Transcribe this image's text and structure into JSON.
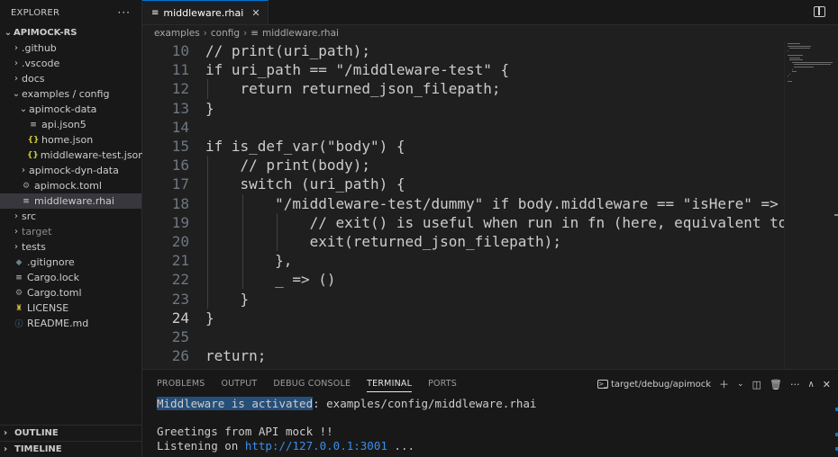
{
  "sidebar": {
    "title": "EXPLORER",
    "more": "···",
    "root": "APIMOCK-RS",
    "items": [
      {
        "label": ".github",
        "chev": "›",
        "indent": 1
      },
      {
        "label": ".vscode",
        "chev": "›",
        "indent": 1
      },
      {
        "label": "docs",
        "chev": "›",
        "indent": 1
      },
      {
        "label": "examples / config",
        "chev": "⌄",
        "indent": 1
      },
      {
        "label": "apimock-data",
        "chev": "⌄",
        "indent": 2
      },
      {
        "label": "api.json5",
        "icon": "≡",
        "indent": 3
      },
      {
        "label": "home.json",
        "icon": "{}",
        "indent": 3
      },
      {
        "label": "middleware-test.json",
        "icon": "{}",
        "indent": 3
      },
      {
        "label": "apimock-dyn-data",
        "chev": "›",
        "indent": 2
      },
      {
        "label": "apimock.toml",
        "icon": "⚙",
        "indent": 2
      },
      {
        "label": "middleware.rhai",
        "icon": "≡",
        "indent": 2
      },
      {
        "label": "src",
        "chev": "›",
        "indent": 1
      },
      {
        "label": "target",
        "chev": "›",
        "indent": 1
      },
      {
        "label": "tests",
        "chev": "›",
        "indent": 1
      },
      {
        "label": ".gitignore",
        "icon": "◆",
        "indent": 1
      },
      {
        "label": "Cargo.lock",
        "icon": "≡",
        "indent": 1
      },
      {
        "label": "Cargo.toml",
        "icon": "⚙",
        "indent": 1
      },
      {
        "label": "LICENSE",
        "icon": "♜",
        "indent": 1
      },
      {
        "label": "README.md",
        "icon": "ⓘ",
        "indent": 1
      }
    ],
    "outline": "OUTLINE",
    "timeline": "TIMELINE"
  },
  "editor": {
    "tab_label": "middleware.rhai",
    "tab_close": "✕",
    "breadcrumb": [
      "examples",
      "config",
      "middleware.rhai"
    ],
    "current_line": 24,
    "lines": [
      {
        "n": "10",
        "text": "// print(uri_path);"
      },
      {
        "n": "11",
        "text": "if uri_path == \"/middleware-test\" {"
      },
      {
        "n": "12",
        "text": "    return returned_json_filepath;"
      },
      {
        "n": "13",
        "text": "}"
      },
      {
        "n": "14",
        "text": ""
      },
      {
        "n": "15",
        "text": "if is_def_var(\"body\") {"
      },
      {
        "n": "16",
        "text": "    // print(body);"
      },
      {
        "n": "17",
        "text": "    switch (uri_path) {"
      },
      {
        "n": "18",
        "text": "        \"/middleware-test/dummy\" if body.middleware == \"isHere\" => {"
      },
      {
        "n": "19",
        "text": "            // exit() is useful when run in fn (here, equivalent to"
      },
      {
        "n": "20",
        "text": "            exit(returned_json_filepath);"
      },
      {
        "n": "21",
        "text": "        },"
      },
      {
        "n": "22",
        "text": "        _ => ()"
      },
      {
        "n": "23",
        "text": "    }"
      },
      {
        "n": "24",
        "text": "}"
      },
      {
        "n": "25",
        "text": ""
      },
      {
        "n": "26",
        "text": "return;"
      }
    ]
  },
  "panel": {
    "tabs": [
      "PROBLEMS",
      "OUTPUT",
      "DEBUG CONSOLE",
      "TERMINAL",
      "PORTS"
    ],
    "active_tab": "TERMINAL",
    "terminal_name": "target/debug/apimock",
    "terminal": {
      "line1_highlight": "Middleware is activated",
      "line1_rest": ": examples/config/middleware.rhai",
      "line3": "Greetings from API mock !!",
      "line4_prefix": "Listening on ",
      "line4_url": "http://127.0.0.1:3001",
      "line4_suffix": " ..."
    }
  }
}
